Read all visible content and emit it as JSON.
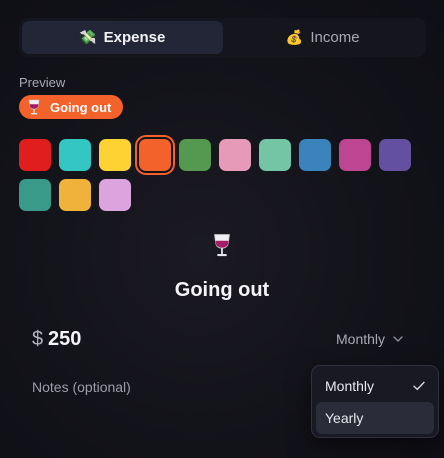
{
  "tabs": [
    {
      "label": "Expense",
      "icon": "money-with-wings-icon",
      "glyph": "💸",
      "active": true
    },
    {
      "label": "Income",
      "icon": "money-bag-icon",
      "glyph": "💰",
      "active": false
    }
  ],
  "preview": {
    "label": "Preview",
    "pill_label": "Going out",
    "pill_color": "#f3622a",
    "icon": "wine-glass-icon"
  },
  "swatches": [
    {
      "color": "#e01e1e",
      "selected": false
    },
    {
      "color": "#33c6c3",
      "selected": false
    },
    {
      "color": "#fdd232",
      "selected": false
    },
    {
      "color": "#f3622a",
      "selected": true
    },
    {
      "color": "#55984f",
      "selected": false
    },
    {
      "color": "#e79ab8",
      "selected": false
    },
    {
      "color": "#74c4a6",
      "selected": false
    },
    {
      "color": "#3b84bb",
      "selected": false
    },
    {
      "color": "#bd4591",
      "selected": false
    },
    {
      "color": "#6450a0",
      "selected": false
    },
    {
      "color": "#3a9a8a",
      "selected": false
    },
    {
      "color": "#efb23a",
      "selected": false
    },
    {
      "color": "#dca4de",
      "selected": false
    }
  ],
  "category": {
    "name": "Going out",
    "icon": "wine-glass-icon"
  },
  "amount": {
    "currency": "$",
    "value": "250"
  },
  "frequency": {
    "selected": "Monthly",
    "options": [
      {
        "label": "Monthly",
        "checked": true,
        "highlighted": false
      },
      {
        "label": "Yearly",
        "checked": false,
        "highlighted": true
      }
    ]
  },
  "notes": {
    "placeholder": "Notes (optional)"
  }
}
